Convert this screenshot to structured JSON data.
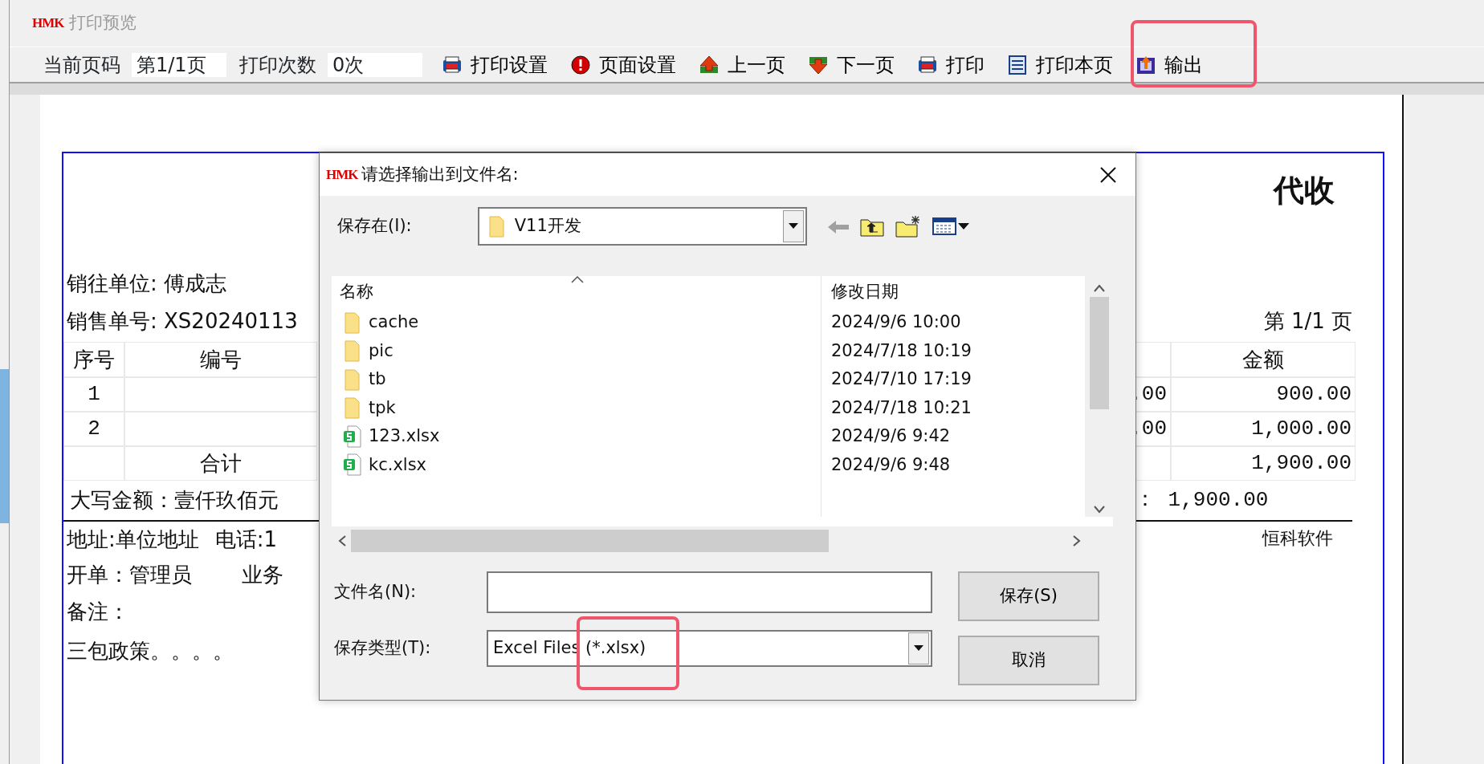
{
  "window": {
    "logo": "HMK",
    "title": "打印预览",
    "active": false
  },
  "toolbar": {
    "page_label": "当前页码",
    "page_value": "第1/1页",
    "count_label": "打印次数",
    "count_value": "0次",
    "buttons": [
      {
        "label": "打印设置",
        "kind": "printer",
        "highlighted": false
      },
      {
        "label": "页面设置",
        "kind": "alert",
        "highlighted": false
      },
      {
        "label": "上一页",
        "kind": "prev",
        "highlighted": false
      },
      {
        "label": "下一页",
        "kind": "next",
        "highlighted": false
      },
      {
        "label": "打印",
        "kind": "printer",
        "highlighted": false
      },
      {
        "label": "打印本页",
        "kind": "document",
        "highlighted": false
      },
      {
        "label": "输出",
        "kind": "export",
        "highlighted": true
      }
    ]
  },
  "document": {
    "title": "代收",
    "customer": "销往单位: 傅成志",
    "order_no": "销售单号: XS20240113",
    "page": "第 1/1 页",
    "columns_left": [
      "序号",
      "编号"
    ],
    "column_right": "金额",
    "rows": [
      {
        "index": "1",
        "partial": ".00",
        "amount": "900.00"
      },
      {
        "index": "2",
        "partial": ".00",
        "amount": "1,000.00"
      },
      {
        "label": "合计",
        "amount": "1,900.00"
      }
    ],
    "amount_words": "大写金额：壹仟玖佰元",
    "amount_total": "： 1,900.00",
    "address": "地址:单位地址",
    "phone": "电话:1",
    "issuer": "开单：管理员",
    "salesperson": "业务",
    "note": "备注：",
    "policy": "三包政策。。。。",
    "company": "恒科软件"
  },
  "dialog": {
    "logo": "HMK",
    "title": "请选择输出到文件名:",
    "save_in_label": "保存在(I):",
    "save_in_value": "V11开发",
    "back_disabled": true,
    "columns": [
      "名称",
      "修改日期"
    ],
    "files": [
      {
        "name": "cache",
        "modified": "2024/9/6 10:00",
        "kind": "folder"
      },
      {
        "name": "pic",
        "modified": "2024/7/18 10:19",
        "kind": "folder"
      },
      {
        "name": "tb",
        "modified": "2024/7/10 17:19",
        "kind": "folder"
      },
      {
        "name": "tpk",
        "modified": "2024/7/18 10:21",
        "kind": "folder"
      },
      {
        "name": "123.xlsx",
        "modified": "2024/9/6 9:42",
        "kind": "spreadsheet"
      },
      {
        "name": "kc.xlsx",
        "modified": "2024/9/6 9:48",
        "kind": "spreadsheet"
      }
    ],
    "file_name_label": "文件名(N):",
    "file_type_label": "保存类型(T):",
    "file_type_value": "Excel Files (*.xlsx)",
    "file_type_highlighted": true,
    "buttons": [
      "保存(S)",
      "取消"
    ]
  }
}
